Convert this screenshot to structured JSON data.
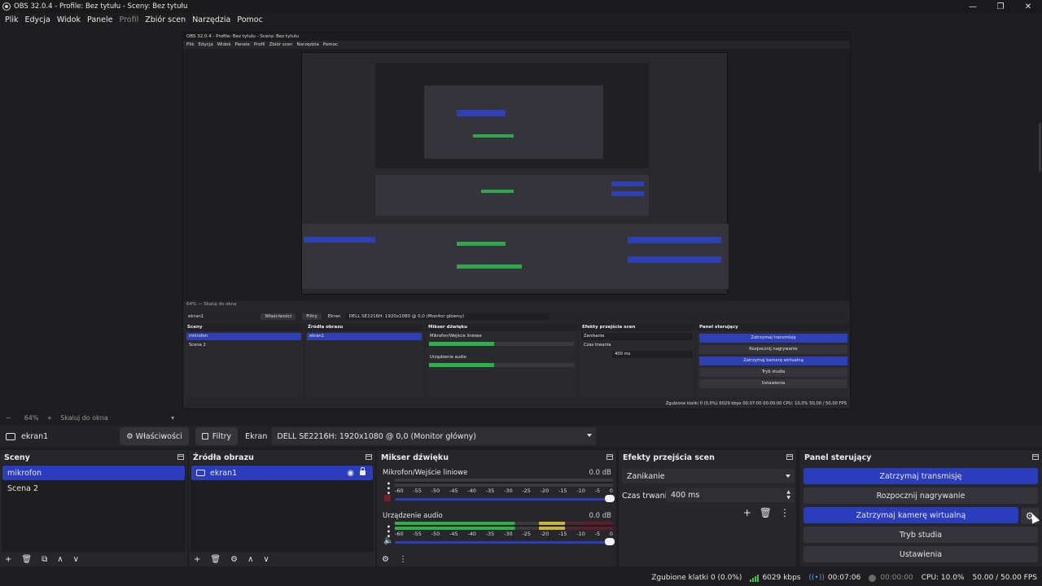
{
  "window": {
    "title": "OBS 32.0.4 - Profile: Bez tytułu - Sceny: Bez tytułu",
    "controls": [
      "—",
      "❐",
      "✕"
    ]
  },
  "menu": [
    "Plik",
    "Edycja",
    "Widok",
    "Panele",
    "Profil",
    "Zbiór scen",
    "Narzędzia",
    "Pomoc"
  ],
  "nested": {
    "title": "OBS 32.0.4 - Profile: Bez tytułu - Sceny: Bez tytułu",
    "menu": [
      "Plik",
      "Edycja",
      "Widok",
      "Panele",
      "Profil",
      "Zbiór scen",
      "Narzędzia",
      "Pomoc"
    ],
    "zoom": "64%   —   Skaluj do okna",
    "source": "ekran1",
    "properties": "Właściwości",
    "filters": "Filtry",
    "screen_label": "Ekran",
    "screen_value": "DELL SE2216H: 1920x1080 @ 0,0 (Monitor główny)",
    "docks": {
      "scenes": "Sceny",
      "sources": "Źródła obrazu",
      "mixer": "Mikser dźwięku",
      "transitions": "Efekty przejścia scen",
      "controls": "Panel sterujący"
    },
    "scene_items": [
      "mikrofon",
      "Scena 2"
    ],
    "source_items": [
      "ekran1"
    ],
    "mixer_items": [
      "Mikrofon/Wejście liniowe",
      "Urządzenie audio"
    ],
    "transition": "Zanikanie",
    "duration_label": "Czas trwania",
    "duration": "400 ms",
    "control_buttons": [
      "Zatrzymaj transmisję",
      "Rozpocznij nagrywanie",
      "Zatrzymaj kamerę wirtualną",
      "Tryb studia",
      "Ustawienia"
    ],
    "status": "Zgubione klatki 0 (0,0%)   6029 kbps   00:07:00   00:00:00   CPU: 10,0%   50,00 / 50,00 FPS"
  },
  "zoom": {
    "minus": "−",
    "level": "64%",
    "plus": "+",
    "scale": "Skaluj do okna"
  },
  "source_toolbar": {
    "source_name": "ekran1",
    "properties": "Właściwości",
    "filters": "Filtry",
    "screen_label": "Ekran",
    "screen_value": "DELL SE2216H: 1920x1080 @ 0,0 (Monitor główny)"
  },
  "scenes": {
    "title": "Sceny",
    "items": [
      "mikrofon",
      "Scena 2"
    ],
    "footer": [
      "+",
      "🗑",
      "⧉",
      "∧",
      "∨"
    ]
  },
  "sources": {
    "title": "Źródła obrazu",
    "items": [
      "ekran1"
    ],
    "footer": [
      "+",
      "🗑",
      "⚙",
      "∧",
      "∨"
    ]
  },
  "mixer": {
    "title": "Mikser dźwięku",
    "channels": [
      {
        "name": "Mikrofon/Wejście liniowe",
        "db": "0.0 dB",
        "level": 0.55
      },
      {
        "name": "Urządzenie audio",
        "db": "0.0 dB",
        "level": 0.78
      }
    ],
    "ticks": [
      "-60",
      "-55",
      "-50",
      "-45",
      "-40",
      "-35",
      "-30",
      "-25",
      "-20",
      "-15",
      "-10",
      "-5",
      "0"
    ],
    "footer": [
      "⚙",
      "⋮"
    ]
  },
  "transitions": {
    "title": "Efekty przejścia scen",
    "selected": "Zanikanie",
    "duration_label": "Czas trwania",
    "duration": "400 ms",
    "actions": [
      "+",
      "🗑",
      "⋮"
    ]
  },
  "controls": {
    "title": "Panel sterujący",
    "buttons": [
      "Zatrzymaj transmisję",
      "Rozpocznij nagrywanie",
      "Zatrzymaj kamerę wirtualną",
      "Tryb studia",
      "Ustawienia"
    ]
  },
  "status": {
    "dropped": "Zgubione klatki 0 (0.0%)",
    "bitrate": "6029 kbps",
    "stream_time": "00:07:06",
    "rec_time": "00:00:00",
    "cpu": "CPU: 10.0%",
    "fps": "50.00 / 50.00 FPS"
  },
  "colors": {
    "accent": "#2b3dbd",
    "meter_green": "#2bb14b",
    "meter_yellow": "#c9b52a",
    "meter_red": "#a8243a"
  }
}
